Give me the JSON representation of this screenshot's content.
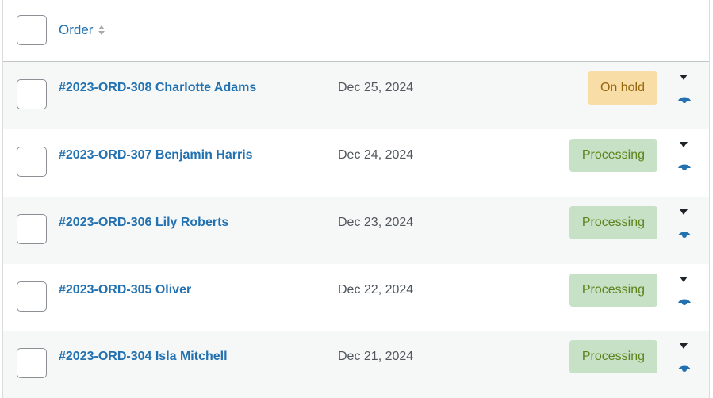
{
  "header": {
    "column_label": "Order",
    "sort_icon": "sort-arrows-icon"
  },
  "colors": {
    "link": "#2271b1",
    "on_hold_bg": "#f8dda7",
    "on_hold_text": "#94660c",
    "processing_bg": "#c6e1c6",
    "processing_text": "#5b841b"
  },
  "orders": [
    {
      "order": "#2023-ORD-308 Charlotte Adams",
      "date": "Dec 25, 2024",
      "status": "On hold"
    },
    {
      "order": "#2023-ORD-307 Benjamin Harris",
      "date": "Dec 24, 2024",
      "status": "Processing"
    },
    {
      "order": "#2023-ORD-306 Lily Roberts",
      "date": "Dec 23, 2024",
      "status": "Processing"
    },
    {
      "order": "#2023-ORD-305 Oliver",
      "date": "Dec 22, 2024",
      "status": "Processing"
    },
    {
      "order": "#2023-ORD-304 Isla Mitchell",
      "date": "Dec 21, 2024",
      "status": "Processing"
    }
  ],
  "row_icons": {
    "expand": "caret-down-icon",
    "preview": "eye-icon"
  }
}
